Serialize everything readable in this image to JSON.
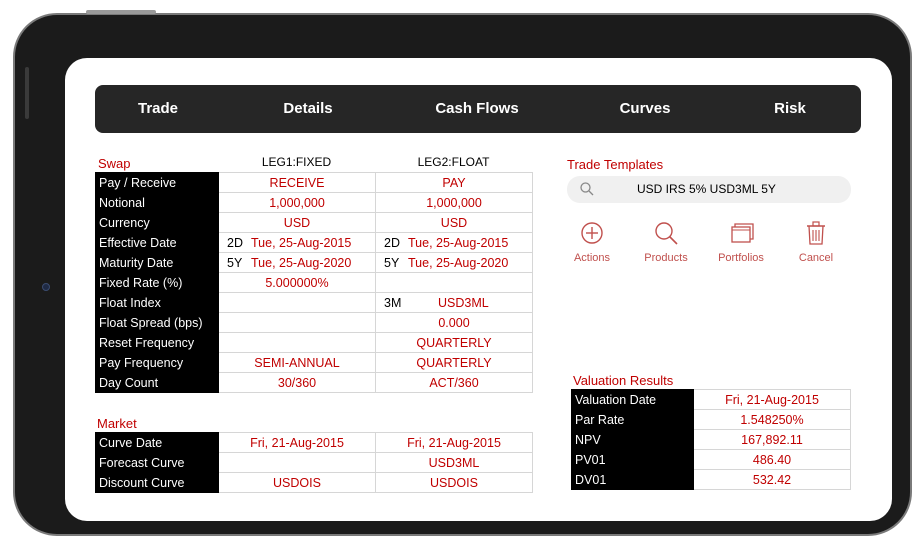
{
  "nav": {
    "tabs": [
      "Trade",
      "Details",
      "Cash Flows",
      "Curves",
      "Risk"
    ]
  },
  "swap": {
    "title": "Swap",
    "leg1_header": "LEG1:FIXED",
    "leg2_header": "LEG2:FLOAT",
    "rows": [
      {
        "label": "Pay / Receive",
        "leg1": "RECEIVE",
        "leg2": "PAY"
      },
      {
        "label": "Notional",
        "leg1": "1,000,000",
        "leg2": "1,000,000"
      },
      {
        "label": "Currency",
        "leg1": "USD",
        "leg2": "USD"
      },
      {
        "label": "Effective Date",
        "leg1_prefix": "2D",
        "leg1": "Tue, 25-Aug-2015",
        "leg2_prefix": "2D",
        "leg2": "Tue, 25-Aug-2015"
      },
      {
        "label": "Maturity Date",
        "leg1_prefix": "5Y",
        "leg1": "Tue, 25-Aug-2020",
        "leg2_prefix": "5Y",
        "leg2": "Tue, 25-Aug-2020"
      },
      {
        "label": "Fixed Rate (%)",
        "leg1": "5.000000%",
        "leg2": ""
      },
      {
        "label": "Float Index",
        "leg1": "",
        "leg2_prefix": "3M",
        "leg2": "USD3ML"
      },
      {
        "label": "Float Spread (bps)",
        "leg1": "",
        "leg2": "0.000"
      },
      {
        "label": "Reset Frequency",
        "leg1": "",
        "leg2": "QUARTERLY"
      },
      {
        "label": "Pay Frequency",
        "leg1": "SEMI-ANNUAL",
        "leg2": "QUARTERLY"
      },
      {
        "label": "Day Count",
        "leg1": "30/360",
        "leg2": "ACT/360"
      }
    ]
  },
  "market": {
    "title": "Market",
    "rows": [
      {
        "label": "Curve Date",
        "leg1": "Fri, 21-Aug-2015",
        "leg2": "Fri, 21-Aug-2015"
      },
      {
        "label": "Forecast Curve",
        "leg1": "",
        "leg2": "USD3ML"
      },
      {
        "label": "Discount Curve",
        "leg1": "USDOIS",
        "leg2": "USDOIS"
      }
    ]
  },
  "templates": {
    "title": "Trade Templates",
    "search_value": "USD IRS 5% USD3ML 5Y",
    "search_icon": "search-icon",
    "actions": [
      {
        "label": "Actions",
        "icon": "plus-circle-icon"
      },
      {
        "label": "Products",
        "icon": "search-icon"
      },
      {
        "label": "Portfolios",
        "icon": "windows-icon"
      },
      {
        "label": "Cancel",
        "icon": "trash-icon"
      }
    ]
  },
  "valuation": {
    "title": "Valuation Results",
    "rows": [
      {
        "label": "Valuation Date",
        "value": "Fri, 21-Aug-2015"
      },
      {
        "label": "Par Rate",
        "value": "1.548250%"
      },
      {
        "label": "NPV",
        "value": "167,892.11"
      },
      {
        "label": "PV01",
        "value": "486.40"
      },
      {
        "label": "DV01",
        "value": "532.42"
      }
    ]
  },
  "colors": {
    "accent": "#c00000",
    "icon": "#c0504d",
    "navbar": "#262626",
    "label_bg": "#000000"
  }
}
